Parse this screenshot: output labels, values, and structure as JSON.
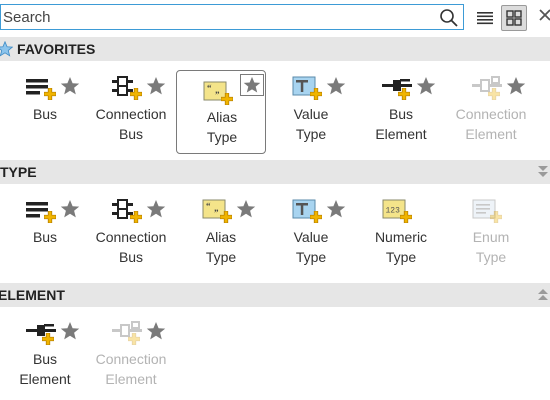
{
  "toolbar": {
    "search_placeholder": "Search",
    "icons": [
      "search-icon",
      "list-view-icon",
      "grid-view-icon",
      "close-icon"
    ],
    "active_view": "grid"
  },
  "colors": {
    "accent": "#3d9bd6",
    "header_bg": "#e6e6e6",
    "star": "#7a7a7a",
    "disabled_text": "#b3b3b3"
  },
  "sections": {
    "favorites": {
      "title": "FAVORITES",
      "items": [
        {
          "line1": "Bus",
          "line2": "",
          "icon": "bus-icon",
          "enabled": true
        },
        {
          "line1": "Connection",
          "line2": "Bus",
          "icon": "connection-bus-icon",
          "enabled": true
        },
        {
          "line1": "Alias",
          "line2": "Type",
          "icon": "alias-type-icon",
          "enabled": true,
          "selected": true
        },
        {
          "line1": "Value",
          "line2": "Type",
          "icon": "value-type-icon",
          "enabled": true
        },
        {
          "line1": "Bus",
          "line2": "Element",
          "icon": "bus-element-icon",
          "enabled": true
        },
        {
          "line1": "Connection",
          "line2": "Element",
          "icon": "connection-element-icon",
          "enabled": false
        }
      ]
    },
    "type": {
      "title": "TYPE",
      "items": [
        {
          "line1": "Bus",
          "line2": "",
          "icon": "bus-icon",
          "enabled": true
        },
        {
          "line1": "Connection",
          "line2": "Bus",
          "icon": "connection-bus-icon",
          "enabled": true
        },
        {
          "line1": "Alias",
          "line2": "Type",
          "icon": "alias-type-icon",
          "enabled": true
        },
        {
          "line1": "Value",
          "line2": "Type",
          "icon": "value-type-icon",
          "enabled": true
        },
        {
          "line1": "Numeric",
          "line2": "Type",
          "icon": "numeric-type-icon",
          "enabled": true
        },
        {
          "line1": "Enum",
          "line2": "Type",
          "icon": "enum-type-icon",
          "enabled": false
        }
      ]
    },
    "element": {
      "title": "ELEMENT",
      "items": [
        {
          "line1": "Bus",
          "line2": "Element",
          "icon": "bus-element-icon",
          "enabled": true
        },
        {
          "line1": "Connection",
          "line2": "Element",
          "icon": "connection-element-icon",
          "enabled": false
        }
      ]
    }
  }
}
